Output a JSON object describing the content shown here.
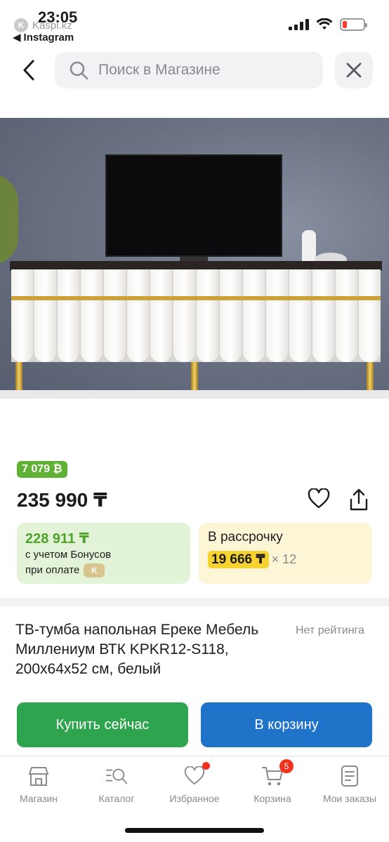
{
  "status_bar": {
    "time": "23:05",
    "carrier": "Kaspi.kz",
    "back_app": "Instagram",
    "battery_level": 0.2,
    "battery_color": "#ff3b30"
  },
  "search": {
    "placeholder": "Поиск в Магазине",
    "icon": "search-icon"
  },
  "product": {
    "bonus_badge": "7 079 ₿",
    "price": "235 990 ₸",
    "bonus_card": {
      "amount": "228 911 ₸",
      "line1": "с учетом Бонусов",
      "line2": "при оплате"
    },
    "installment": {
      "label": "В рассрочку",
      "monthly": "19 666 ₸",
      "months": "× 12"
    },
    "title": "ТВ-тумба напольная Ереке Мебель Миллениум ВТК KPKR12-S118, 200x64x52 см, белый",
    "rating": "Нет рейтинга"
  },
  "actions": {
    "buy_now": "Купить сейчас",
    "to_cart": "В корзину"
  },
  "bottom_nav": [
    {
      "label": "Магазин",
      "icon": "store-icon"
    },
    {
      "label": "Каталог",
      "icon": "catalog-search-icon"
    },
    {
      "label": "Избранное",
      "icon": "heart-icon",
      "dot": true
    },
    {
      "label": "Корзина",
      "icon": "cart-icon",
      "badge": "5"
    },
    {
      "label": "Мои заказы",
      "icon": "orders-icon"
    }
  ],
  "colors": {
    "green": "#2ea44f",
    "blue": "#1f73c9",
    "bonus_green": "#5fb233",
    "highlight_yellow": "#f7d331",
    "badge_red": "#f0311d"
  }
}
